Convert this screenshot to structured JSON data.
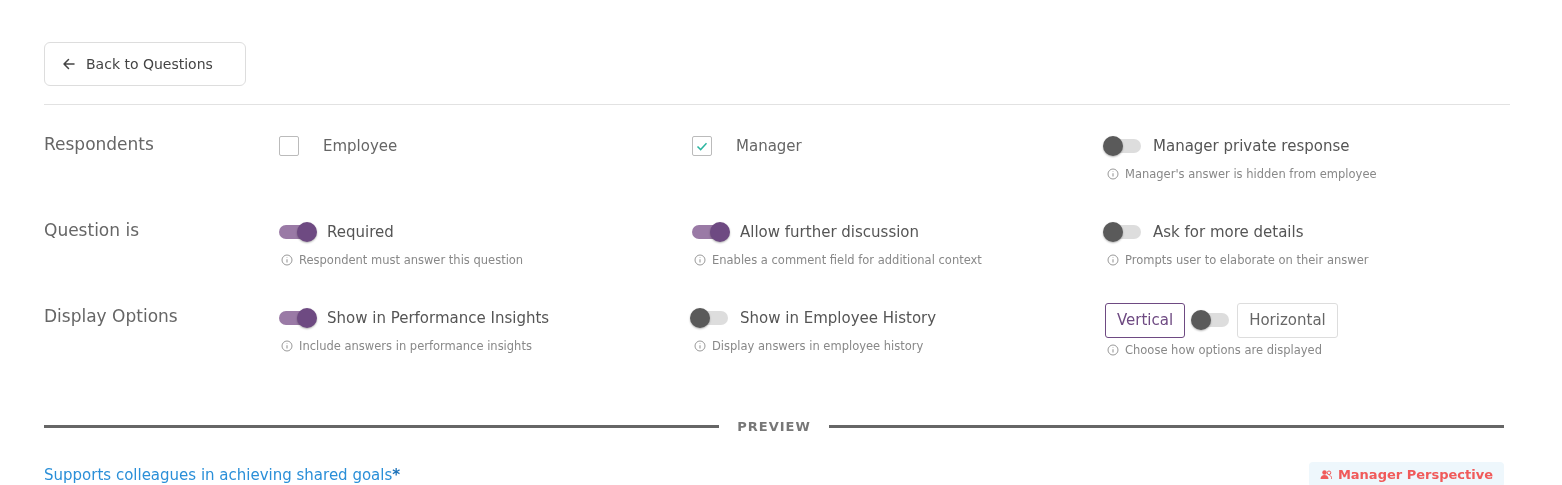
{
  "back_button": {
    "label": "Back to Questions"
  },
  "settings": [
    {
      "label": "Respondents",
      "items": [
        {
          "kind": "checkbox",
          "label": "Employee",
          "checked": false
        },
        {
          "kind": "checkbox",
          "label": "Manager",
          "checked": true
        },
        {
          "kind": "toggle",
          "label": "Manager private response",
          "on": false,
          "hint": "Manager's answer is hidden from employee"
        }
      ]
    },
    {
      "label": "Question is",
      "items": [
        {
          "kind": "toggle",
          "label": "Required",
          "on": true,
          "hint": "Respondent must answer this question"
        },
        {
          "kind": "toggle",
          "label": "Allow further discussion",
          "on": true,
          "hint": "Enables a comment field for additional context"
        },
        {
          "kind": "toggle",
          "label": "Ask for more details",
          "on": false,
          "hint": "Prompts user to elaborate on their answer"
        }
      ]
    },
    {
      "label": "Display Options",
      "items": [
        {
          "kind": "toggle",
          "label": "Show in Performance Insights",
          "on": true,
          "hint": "Include answers in performance insights"
        },
        {
          "kind": "toggle",
          "label": "Show in Employee History",
          "on": false,
          "hint": "Display answers in employee history"
        },
        {
          "kind": "orientation",
          "options": [
            {
              "label": "Vertical",
              "selected": true
            },
            {
              "label": "Horizontal",
              "selected": false
            }
          ],
          "hint": "Choose how options are displayed"
        }
      ]
    }
  ],
  "preview": {
    "heading": "PREVIEW",
    "question": "Supports colleagues in achieving shared goals",
    "required_mark": "*",
    "badge": "Manager Perspective"
  }
}
